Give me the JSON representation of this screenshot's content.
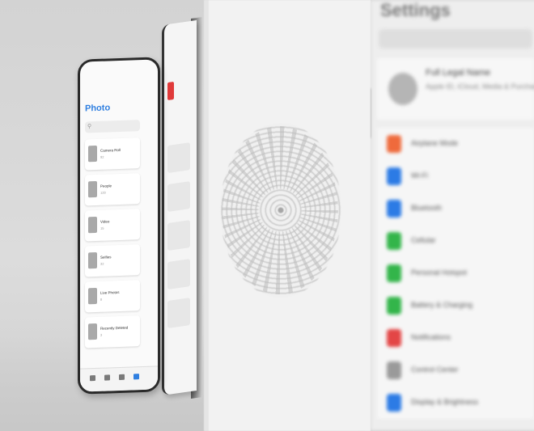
{
  "photo_app": {
    "title": "Photo",
    "search_placeholder": "Search",
    "albums": [
      {
        "label": "Camera Roll",
        "count": "92"
      },
      {
        "label": "People",
        "count": "128"
      },
      {
        "label": "Video",
        "count": "15"
      },
      {
        "label": "Selfies",
        "count": "32"
      },
      {
        "label": "Live Photos",
        "count": "8"
      },
      {
        "label": "Recently Deleted",
        "count": "3"
      }
    ],
    "tabs": [
      "photos",
      "for-you",
      "albums",
      "search"
    ],
    "accent": "#2f7fe0"
  },
  "colors": {
    "red_accent": "#e03a3a",
    "settings_icons": [
      "#ef6a3c",
      "#2c7be5",
      "#2c7be5",
      "#33b54a",
      "#33b54a",
      "#33b54a",
      "#e34646",
      "#9a9a9a",
      "#2c7be5"
    ]
  },
  "settings_app": {
    "title": "Settings",
    "profile_name": "Full Legal Name",
    "profile_sub": "Apple ID, iCloud, Media & Purchases",
    "rows": [
      {
        "label": "Airplane Mode",
        "icon": "airplane-icon"
      },
      {
        "label": "Wi-Fi",
        "icon": "wifi-icon"
      },
      {
        "label": "Bluetooth",
        "icon": "bluetooth-icon"
      },
      {
        "label": "Cellular",
        "icon": "cellular-icon"
      },
      {
        "label": "Personal Hotspot",
        "icon": "hotspot-icon"
      },
      {
        "label": "Battery & Charging",
        "icon": "battery-icon"
      },
      {
        "label": "Notifications",
        "icon": "bell-icon"
      },
      {
        "label": "Control Center",
        "icon": "sliders-icon"
      },
      {
        "label": "Display & Brightness",
        "icon": "brightness-icon"
      }
    ]
  }
}
